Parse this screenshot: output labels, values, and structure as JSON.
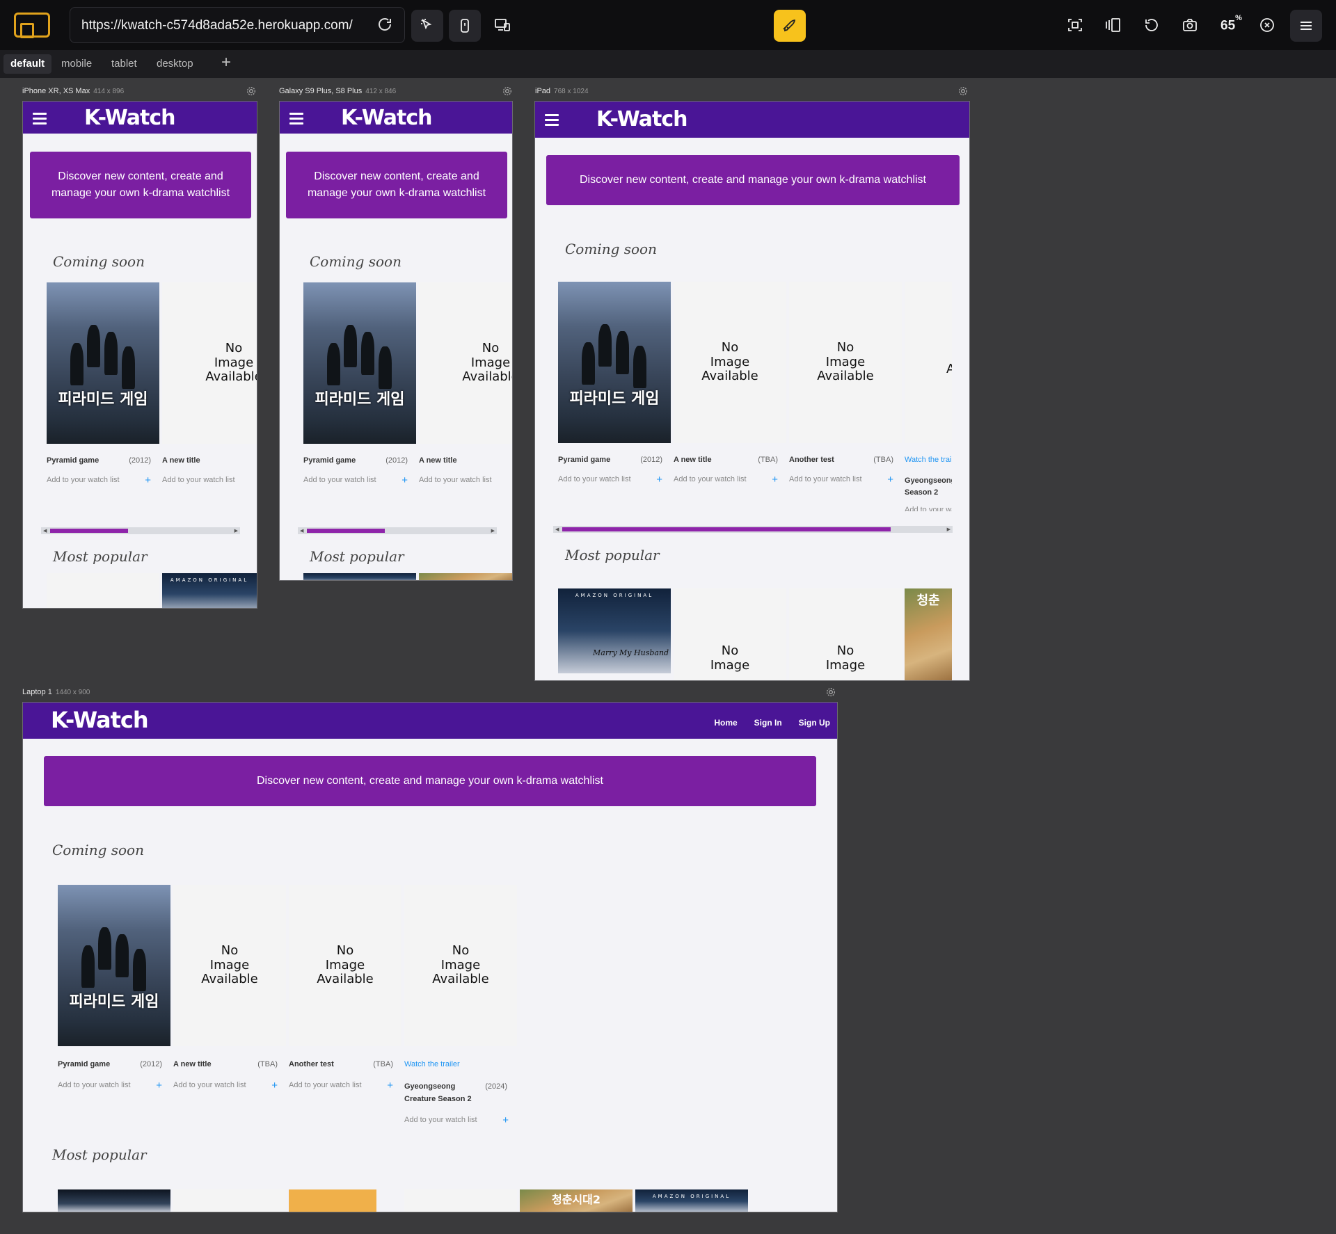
{
  "toolbar": {
    "url": "https://kwatch-c574d8ada52e.herokuapp.com/",
    "zoom": "65",
    "zoom_unit": "%"
  },
  "device_tabs": [
    "default",
    "mobile",
    "tablet",
    "desktop"
  ],
  "frames": {
    "iphone": {
      "name": "iPhone XR, XS Max",
      "dims": "414 x 896"
    },
    "galaxy": {
      "name": "Galaxy S9 Plus, S8 Plus",
      "dims": "412 x 846"
    },
    "ipad": {
      "name": "iPad",
      "dims": "768 x 1024"
    },
    "laptop": {
      "name": "Laptop 1",
      "dims": "1440 x 900"
    }
  },
  "site": {
    "logo": "K-Watch",
    "nav": [
      "Home",
      "Sign In",
      "Sign Up"
    ],
    "hero": "Discover new content, create and manage your own k-drama watchlist",
    "hero_wrap_1": "Discover new content, create and",
    "hero_wrap_2": "manage your own k-drama watchlist",
    "coming_soon": "Coming soon",
    "most_popular": "Most popular",
    "no_image_1": "No",
    "no_image_2": "Image",
    "no_image_3": "Available",
    "add_label": "Add to your watch list",
    "cards": [
      {
        "title": "Pyramid game",
        "year": "(2012)",
        "poster_text": "피라미드 게임"
      },
      {
        "title": "A new title",
        "year": "(TBA)"
      },
      {
        "title": "Another test",
        "year": "(TBA)"
      },
      {
        "title": "Gyeongseong Creature Season 2",
        "title_l1": "Gyeongseong",
        "title_l2": "Creature Season 2",
        "year": "(2024)",
        "link": "Watch the trailer"
      }
    ],
    "popular_posters": {
      "amazon": "AMAZON ORIGINAL",
      "marry": "Marry My Husband",
      "warm": "청춘",
      "warm_long": "청춘시대2"
    },
    "ipad_scroll_position": 0.84,
    "mobile_scroll_position": 0.4
  }
}
